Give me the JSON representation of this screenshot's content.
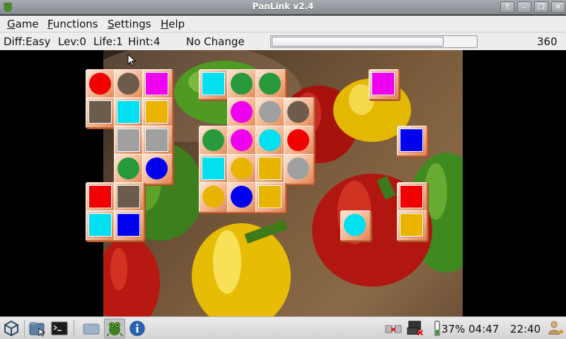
{
  "window": {
    "title": "PanLink v2.4",
    "buttons": [
      {
        "name": "raise-button",
        "glyph": "↑"
      },
      {
        "name": "minimize-button",
        "glyph": "–"
      },
      {
        "name": "maximize-button",
        "glyph": "❐"
      },
      {
        "name": "close-button",
        "glyph": "✕"
      }
    ]
  },
  "menu": {
    "game": {
      "accel": "G",
      "rest": "ame"
    },
    "functions": {
      "accel": "F",
      "rest": "unctions"
    },
    "settings": {
      "accel": "S",
      "rest": "ettings"
    },
    "help": {
      "accel": "H",
      "rest": "elp"
    }
  },
  "status": {
    "difficulty": "Diff:Easy",
    "level": "Lev:0",
    "life": "Life:1",
    "hint": "Hint:4",
    "message": "No Change",
    "time_progress": 0.84,
    "score": "360"
  },
  "colors": {
    "red": "#f00000",
    "brown": "#6d5c4c",
    "magenta": "#f000f0",
    "cyan": "#00e0f0",
    "green": "#289a3c",
    "gray": "#a0a0a0",
    "yellow": "#e8b400",
    "blue": "#0000f0"
  },
  "tiles": [
    {
      "shape": "circle",
      "color": "red"
    },
    {
      "shape": "circle",
      "color": "brown"
    },
    {
      "shape": "square",
      "color": "magenta"
    },
    {
      "shape": "square",
      "color": "cyan"
    },
    {
      "shape": "circle",
      "color": "green"
    },
    {
      "shape": "circle",
      "color": "green"
    },
    {
      "shape": "square",
      "color": "magenta"
    },
    {
      "shape": "square",
      "color": "brown"
    },
    {
      "shape": "square",
      "color": "cyan"
    },
    {
      "shape": "square",
      "color": "yellow"
    },
    {
      "shape": "circle",
      "color": "magenta"
    },
    {
      "shape": "circle",
      "color": "gray"
    },
    {
      "shape": "circle",
      "color": "brown"
    },
    {
      "shape": "square",
      "color": "gray"
    },
    {
      "shape": "square",
      "color": "gray"
    },
    {
      "shape": "circle",
      "color": "green"
    },
    {
      "shape": "circle",
      "color": "magenta"
    },
    {
      "shape": "circle",
      "color": "cyan"
    },
    {
      "shape": "circle",
      "color": "red"
    },
    {
      "shape": "square",
      "color": "blue"
    },
    {
      "shape": "circle",
      "color": "green"
    },
    {
      "shape": "circle",
      "color": "blue"
    },
    {
      "shape": "square",
      "color": "cyan"
    },
    {
      "shape": "circle",
      "color": "yellow"
    },
    {
      "shape": "square",
      "color": "yellow"
    },
    {
      "shape": "circle",
      "color": "gray"
    },
    {
      "shape": "square",
      "color": "red"
    },
    {
      "shape": "square",
      "color": "brown"
    },
    {
      "shape": "circle",
      "color": "yellow"
    },
    {
      "shape": "circle",
      "color": "blue"
    },
    {
      "shape": "square",
      "color": "yellow"
    },
    {
      "shape": "square",
      "color": "red"
    },
    {
      "shape": "square",
      "color": "cyan"
    },
    {
      "shape": "square",
      "color": "blue"
    },
    {
      "shape": "circle",
      "color": "cyan"
    },
    {
      "shape": "square",
      "color": "yellow"
    }
  ],
  "taskbar": {
    "battery": "37% 04:47",
    "clock": "22:40",
    "launchers": [
      "start-menu-icon",
      "file-manager-icon",
      "terminal-icon",
      "show-desktop-icon",
      "panlink-app-icon",
      "info-icon"
    ],
    "tray": [
      "network-icon",
      "display-disconnected-icon",
      "battery-icon",
      "logout-icon"
    ]
  }
}
